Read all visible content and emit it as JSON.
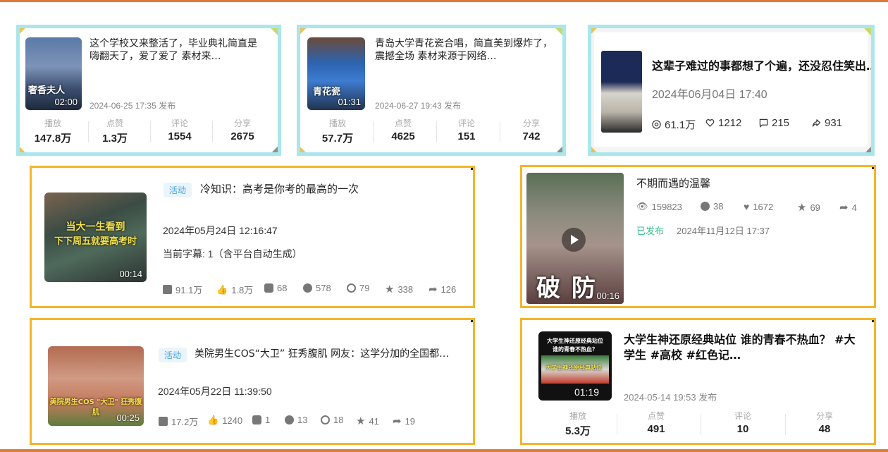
{
  "cards": {
    "c1": {
      "thumb_caption": "奢香夫人",
      "duration": "02:00",
      "title": "这个学校又来整活了，毕业典礼简直是嗨翻天了，爱了爱了 素材来…",
      "date": "2024-06-25 17:35 发布",
      "stats": [
        {
          "label": "播放",
          "value": "147.8万"
        },
        {
          "label": "点赞",
          "value": "1.3万"
        },
        {
          "label": "评论",
          "value": "1554"
        },
        {
          "label": "分享",
          "value": "2675"
        }
      ]
    },
    "c2": {
      "thumb_caption": "青花瓷",
      "duration": "01:31",
      "title": "青岛大学青花瓷合唱，简直美到爆炸了，震撼全场 素材来源于网络…",
      "date": "2024-06-27 19:43 发布",
      "stats": [
        {
          "label": "播放",
          "value": "57.7万"
        },
        {
          "label": "点赞",
          "value": "4625"
        },
        {
          "label": "评论",
          "value": "151"
        },
        {
          "label": "分享",
          "value": "742"
        }
      ]
    },
    "c3": {
      "title": "这辈子难过的事都想了个遍，还没忍住笑出…",
      "date": "2024年06月04日 17:40",
      "views": "61.1万",
      "likes": "1212",
      "comments": "215",
      "shares": "931"
    },
    "c4": {
      "tag": "活动",
      "title": "冷知识：高考是你考的最高的一次",
      "thumb_caption_1": "当大一生看到",
      "thumb_caption_2": "下下周五就要高考时",
      "duration": "00:14",
      "date": "2024年05月24日 12:16:47",
      "subtitle_info": "当前字幕: 1（含平台自动生成）",
      "stats": [
        "91.1万",
        "1.8万",
        "68",
        "578",
        "79",
        "338",
        "126"
      ]
    },
    "c5": {
      "title": "不期而遇的温馨",
      "thumb_caption": "破 防",
      "duration": "00:16",
      "stats": [
        "159823",
        "38",
        "1672",
        "69",
        "4"
      ],
      "status": "已发布",
      "date": "2024年11月12日 17:37"
    },
    "c6": {
      "tag": "活动",
      "title": "美院男生COS“大卫” 狂秀腹肌 网友：这学分加的全国都…",
      "thumb_caption": "美院男生COS \"大卫\" 狂秀腹肌",
      "duration": "00:25",
      "date": "2024年05月22日 11:39:50",
      "stats": [
        "17.2万",
        "1240",
        "1",
        "13",
        "18",
        "41",
        "19"
      ]
    },
    "c7": {
      "thumb_caption_1": "大学生神还原经典站位",
      "thumb_caption_2": "谁的青春不热血？",
      "thumb_caption_3": "大学生神还原经典站位",
      "duration": "01:19",
      "title": "大学生神还原经典站位 谁的青春不热血？ #大学生 #高校 #红色记…",
      "date": "2024-05-14 19:53 发布",
      "stats": [
        {
          "label": "播放",
          "value": "5.3万"
        },
        {
          "label": "点赞",
          "value": "491"
        },
        {
          "label": "评论",
          "value": "10"
        },
        {
          "label": "分享",
          "value": "48"
        }
      ]
    }
  },
  "colors": {
    "accent_orange": "#e07b39",
    "cyan_border": "#a9e7ec",
    "gold_border": "#f3b62a",
    "tag_blue": "#4aa5dd",
    "published_green": "#3bbf8c"
  }
}
